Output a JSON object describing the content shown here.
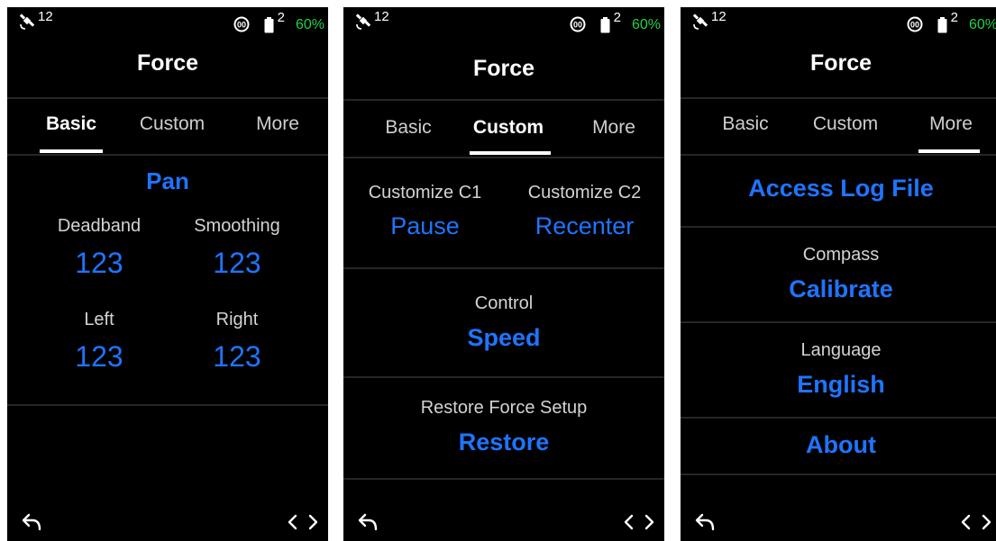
{
  "status": {
    "sat_count": "12",
    "battery_count": "2",
    "battery_pct": "60%"
  },
  "title": "Force",
  "tabs": [
    "Basic",
    "Custom",
    "More"
  ],
  "basic": {
    "axis": "Pan",
    "deadband_label": "Deadband",
    "deadband_value": "123",
    "smoothing_label": "Smoothing",
    "smoothing_value": "123",
    "left_label": "Left",
    "left_value": "123",
    "right_label": "Right",
    "right_value": "123"
  },
  "custom": {
    "c1_label": "Customize C1",
    "c1_value": "Pause",
    "c2_label": "Customize C2",
    "c2_value": "Recenter",
    "control_label": "Control",
    "control_value": "Speed",
    "restore_label": "Restore Force Setup",
    "restore_value": "Restore"
  },
  "more": {
    "access_log": "Access Log File",
    "compass_label": "Compass",
    "compass_value": "Calibrate",
    "language_label": "Language",
    "language_value": "English",
    "about": "About"
  },
  "icons": {
    "satellite": "satellite-icon",
    "gyro": "gyro-icon",
    "battery": "battery-icon",
    "back": "back-icon",
    "nav": "nav-arrows-icon"
  },
  "colors": {
    "accent_blue": "#1f74ff",
    "battery_green": "#1fd24a",
    "background": "#000000"
  }
}
